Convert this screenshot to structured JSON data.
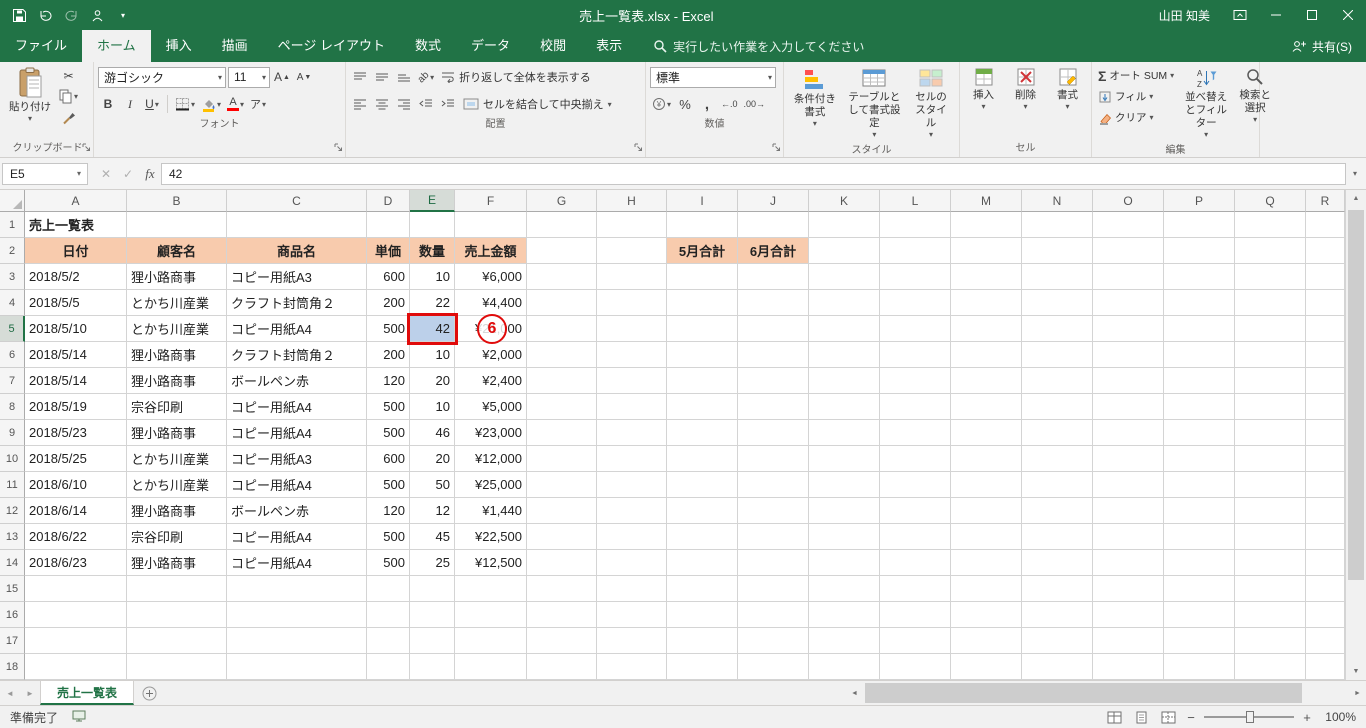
{
  "titlebar": {
    "title": "売上一覧表.xlsx  -  Excel",
    "user": "山田 知美"
  },
  "ribbon": {
    "file_tab": "ファイル",
    "tabs": [
      "ホーム",
      "挿入",
      "描画",
      "ページ レイアウト",
      "数式",
      "データ",
      "校閲",
      "表示"
    ],
    "active_tab": "ホーム",
    "search_text": "実行したい作業を入力してください",
    "share_label": "共有(S)",
    "clipboard": {
      "paste": "貼り付け",
      "label": "クリップボード"
    },
    "font": {
      "font_name": "游ゴシック",
      "font_size": "11",
      "label": "フォント"
    },
    "alignment": {
      "wrap": "折り返して全体を表示する",
      "merge": "セルを結合して中央揃え",
      "label": "配置"
    },
    "number": {
      "format": "標準",
      "label": "数値"
    },
    "styles": {
      "conditional": "条件付き書式",
      "table": "テーブルとして書式設定",
      "cell_styles": "セルのスタイル",
      "label": "スタイル"
    },
    "cells": {
      "insert": "挿入",
      "delete": "削除",
      "format": "書式",
      "label": "セル"
    },
    "editing": {
      "autosum": "オート SUM",
      "fill": "フィル",
      "clear": "クリア",
      "sort": "並べ替えとフィルター",
      "find": "検索と選択",
      "label": "編集"
    }
  },
  "formula_bar": {
    "cell_ref": "E5",
    "value": "42"
  },
  "grid": {
    "column_letters": [
      "A",
      "B",
      "C",
      "D",
      "E",
      "F",
      "G",
      "H",
      "I",
      "J",
      "K",
      "L",
      "M",
      "N",
      "O",
      "P",
      "Q",
      "R"
    ],
    "row_numbers": [
      1,
      2,
      3,
      4,
      5,
      6,
      7,
      8,
      9,
      10,
      11,
      12,
      13,
      14,
      15,
      16,
      17,
      18
    ],
    "selected_column": "E",
    "selected_row": 5,
    "title_cell": "売上一覧表",
    "header_row": {
      "A": "日付",
      "B": "顧客名",
      "C": "商品名",
      "D": "単価",
      "E": "数量",
      "F": "売上金額",
      "I": "5月合計",
      "J": "6月合計"
    },
    "records": [
      {
        "date": "2018/5/2",
        "customer": "狸小路商事",
        "product": "コピー用紙A3",
        "price": "600",
        "qty": "10",
        "amount": "¥6,000"
      },
      {
        "date": "2018/5/5",
        "customer": "とかち川産業",
        "product": "クラフト封筒角２",
        "price": "200",
        "qty": "22",
        "amount": "¥4,400"
      },
      {
        "date": "2018/5/10",
        "customer": "とかち川産業",
        "product": "コピー用紙A4",
        "price": "500",
        "qty": "42",
        "amount": "¥21,000"
      },
      {
        "date": "2018/5/14",
        "customer": "狸小路商事",
        "product": "クラフト封筒角２",
        "price": "200",
        "qty": "10",
        "amount": "¥2,000"
      },
      {
        "date": "2018/5/14",
        "customer": "狸小路商事",
        "product": "ボールペン赤",
        "price": "120",
        "qty": "20",
        "amount": "¥2,400"
      },
      {
        "date": "2018/5/19",
        "customer": "宗谷印刷",
        "product": "コピー用紙A4",
        "price": "500",
        "qty": "10",
        "amount": "¥5,000"
      },
      {
        "date": "2018/5/23",
        "customer": "狸小路商事",
        "product": "コピー用紙A4",
        "price": "500",
        "qty": "46",
        "amount": "¥23,000"
      },
      {
        "date": "2018/5/25",
        "customer": "とかち川産業",
        "product": "コピー用紙A3",
        "price": "600",
        "qty": "20",
        "amount": "¥12,000"
      },
      {
        "date": "2018/6/10",
        "customer": "とかち川産業",
        "product": "コピー用紙A4",
        "price": "500",
        "qty": "50",
        "amount": "¥25,000"
      },
      {
        "date": "2018/6/14",
        "customer": "狸小路商事",
        "product": "ボールペン赤",
        "price": "120",
        "qty": "12",
        "amount": "¥1,440"
      },
      {
        "date": "2018/6/22",
        "customer": "宗谷印刷",
        "product": "コピー用紙A4",
        "price": "500",
        "qty": "45",
        "amount": "¥22,500"
      },
      {
        "date": "2018/6/23",
        "customer": "狸小路商事",
        "product": "コピー用紙A4",
        "price": "500",
        "qty": "25",
        "amount": "¥12,500"
      }
    ],
    "annotation_label": "6"
  },
  "sheet_tabs": {
    "active": "売上一覧表"
  },
  "status_bar": {
    "ready": "準備完了",
    "zoom": "100%"
  }
}
